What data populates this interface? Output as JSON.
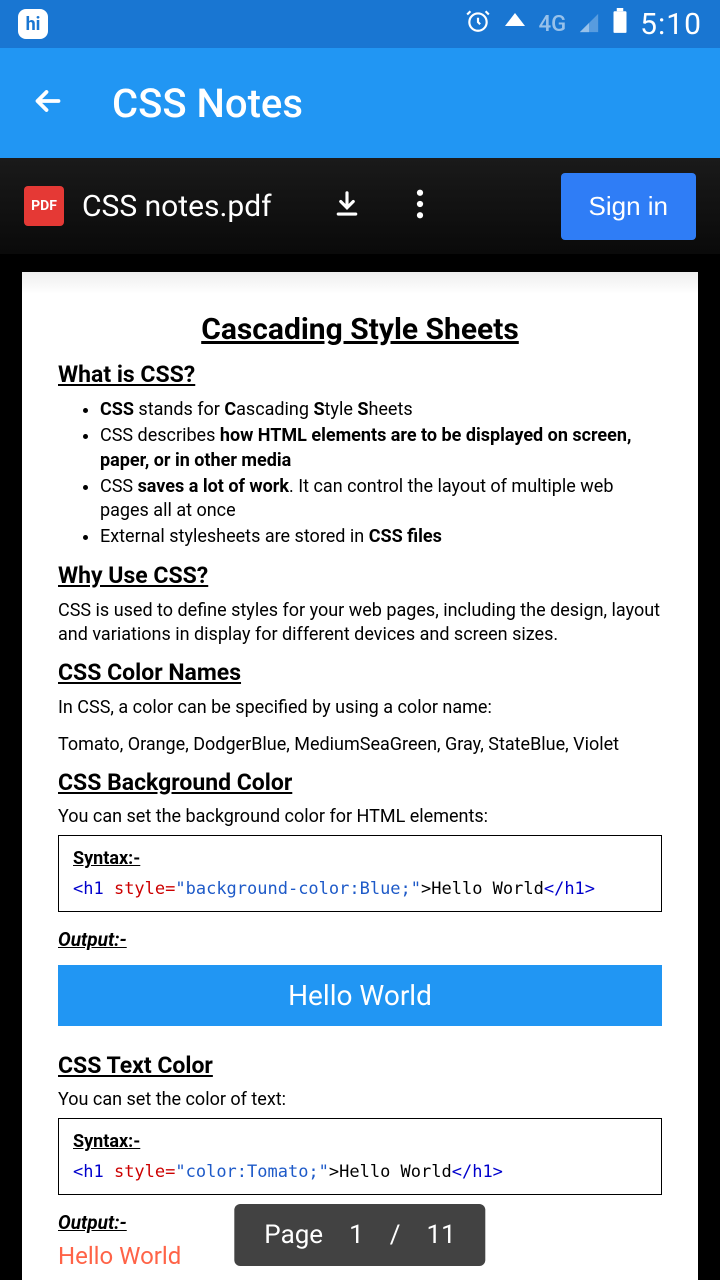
{
  "status": {
    "hi": "hi",
    "network": "4G",
    "time": "5:10"
  },
  "app": {
    "title": "CSS Notes"
  },
  "pdf": {
    "badge": "PDF",
    "filename": "CSS notes.pdf",
    "signin": "Sign in"
  },
  "doc": {
    "title": "Cascading Style Sheets",
    "s1_h": "What is CSS?",
    "b1a": "CSS",
    "b1b": " stands for ",
    "b1c": "C",
    "b1d": "ascading ",
    "b1e": "S",
    "b1f": "tyle ",
    "b1g": "S",
    "b1h": "heets",
    "b2a": "CSS describes ",
    "b2b": "how HTML elements are to be displayed on screen, paper, or in other media",
    "b3a": "CSS ",
    "b3b": "saves a lot of work",
    "b3c": ". It can control the layout of multiple web pages all at once",
    "b4a": "External stylesheets are stored in ",
    "b4b": "CSS files",
    "s2_h": "Why Use CSS?",
    "s2_p": "CSS is used to define styles for your web pages, including the design, layout and variations in display for different devices and screen sizes.",
    "s3_h": "CSS Color Names",
    "s3_p1": "In CSS, a color can be specified by using a color name:",
    "s3_p2": "Tomato, Orange, DodgerBlue, MediumSeaGreen, Gray, StateBlue, Violet",
    "s4_h": "CSS Background Color",
    "s4_p": "You can set the background color for HTML elements:",
    "syntax": "Syntax:-",
    "code1_open": "<h1 ",
    "code1_attr": "style=",
    "code1_val": "\"background-color:Blue;\"",
    "code1_mid": ">Hello World",
    "code1_close": "</h1>",
    "output": "Output:-",
    "hello1": "Hello World",
    "s5_h": "CSS Text Color",
    "s5_p": "You can set the color of text:",
    "code2_open": "<h1 ",
    "code2_attr": "style=",
    "code2_val": "\"color:Tomato;\"",
    "code2_mid": ">Hello World",
    "code2_close": "</h1>",
    "hello2": "Hello World"
  },
  "indicator": {
    "label": "Page",
    "current": "1",
    "sep": "/",
    "total": "11"
  }
}
